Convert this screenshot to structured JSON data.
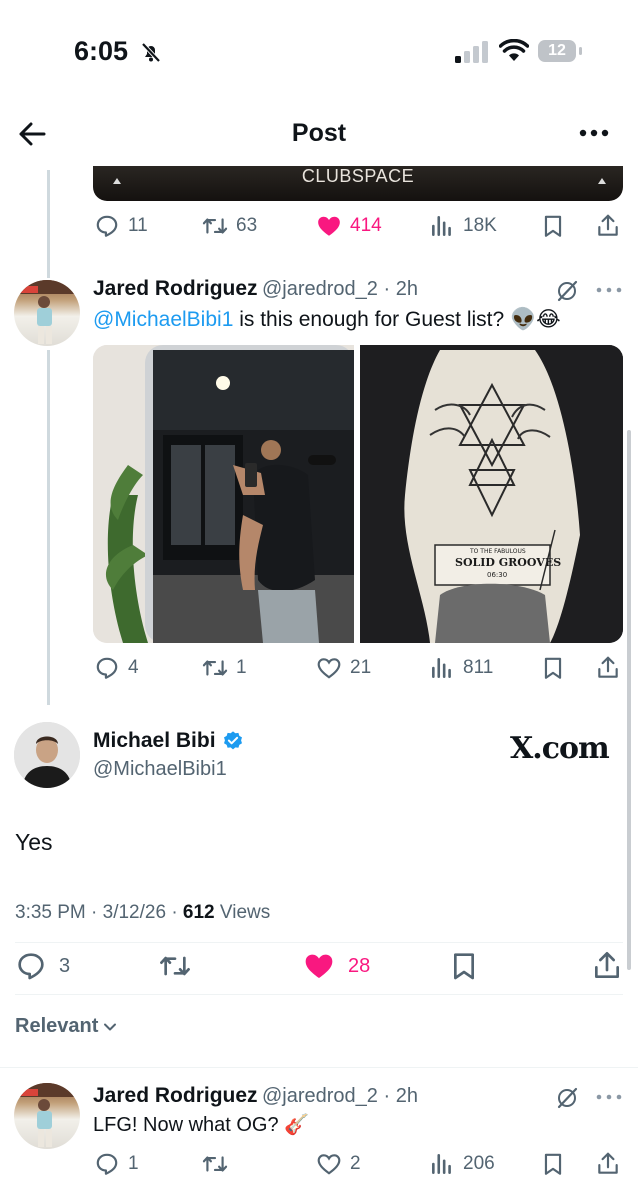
{
  "status_bar": {
    "time": "6:05",
    "battery": "12"
  },
  "header": {
    "title": "Post"
  },
  "quoted_media": {
    "text": "CLUBSPACE"
  },
  "tweet1_stats": {
    "replies": "11",
    "reposts": "63",
    "likes": "414",
    "views": "18K"
  },
  "tweet2": {
    "name": "Jared Rodriguez",
    "handle": "@jaredrod_2",
    "time": "2h",
    "mention": "@MichaelBibi1",
    "text": " is this enough for Guest list? 👽😂",
    "poster": {
      "line1": "TO THE FABULOUS",
      "line2": "SOLID GROOVES",
      "line3": "06:30"
    },
    "stats": {
      "replies": "4",
      "reposts": "1",
      "likes": "21",
      "views": "811"
    }
  },
  "main_tweet": {
    "name": "Michael Bibi",
    "handle": "@MichaelBibi1",
    "watermark": "X.com",
    "text": "Yes",
    "time": "3:35 PM · 3/12/26 · ",
    "views_count": "612",
    "views_label": " Views",
    "stats": {
      "replies": "3",
      "likes": "28"
    }
  },
  "sort": {
    "label": "Relevant"
  },
  "reply": {
    "name": "Jared Rodriguez",
    "handle": "@jaredrod_2",
    "time": "2h",
    "text": "LFG! Now what OG? 🎸",
    "stats": {
      "replies": "1",
      "likes": "2",
      "views": "206"
    }
  },
  "colors": {
    "like": "#f91880",
    "verified": "#1d9bf0",
    "text": "#0f1419",
    "secondary": "#536471"
  }
}
